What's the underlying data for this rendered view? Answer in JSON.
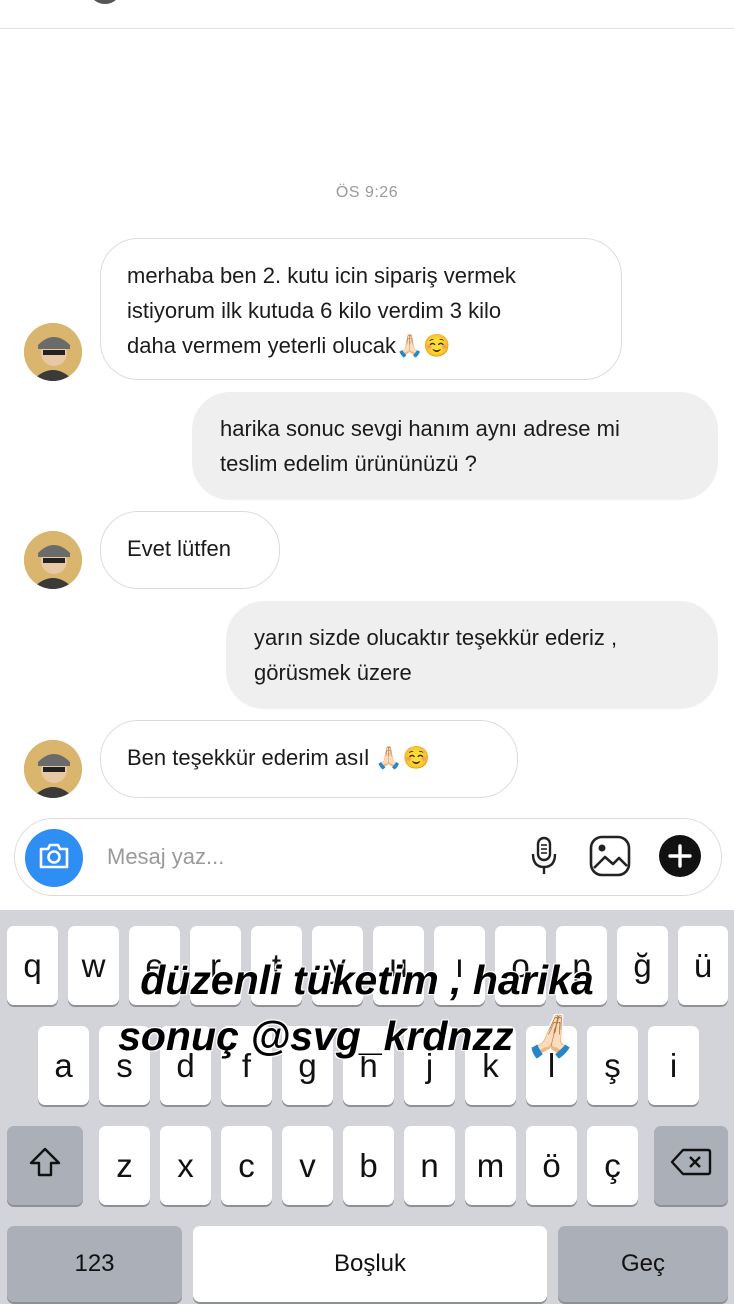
{
  "timestamp": "ÖS 9:26",
  "messages": [
    {
      "direction": "incoming",
      "lines": [
        "merhaba ben 2. kutu icin sipariş vermek",
        "istiyorum ilk kutuda 6 kilo verdim 3 kilo",
        "daha vermem yeterli olucak🙏🏻☺️"
      ]
    },
    {
      "direction": "outgoing",
      "lines": [
        "harika sonuc sevgi hanım aynı adrese mi",
        "teslim edelim ürününüzü ?"
      ]
    },
    {
      "direction": "incoming",
      "lines": [
        "Evet lütfen"
      ]
    },
    {
      "direction": "outgoing",
      "lines": [
        "yarın sizde olucaktır teşekkür ederiz ,",
        "görüsmek üzere"
      ]
    },
    {
      "direction": "incoming",
      "lines": [
        "Ben teşekkür ederim asıl 🙏🏻☺️"
      ]
    }
  ],
  "composer": {
    "placeholder": "Mesaj yaz...",
    "camera_icon": "camera-icon",
    "mic_icon": "microphone-icon",
    "gallery_icon": "gallery-icon",
    "plus_icon": "plus-icon"
  },
  "keyboard": {
    "row1": [
      "q",
      "w",
      "e",
      "r",
      "t",
      "y",
      "u",
      "ı",
      "o",
      "p",
      "ğ",
      "ü"
    ],
    "row2": [
      "a",
      "s",
      "d",
      "f",
      "g",
      "h",
      "j",
      "k",
      "l",
      "ş",
      "i"
    ],
    "row3": [
      "z",
      "x",
      "c",
      "v",
      "b",
      "n",
      "m",
      "ö",
      "ç"
    ],
    "shift_icon": "shift-icon",
    "backspace_icon": "backspace-icon",
    "numbers_label": "123",
    "space_label": "Boşluk",
    "return_label": "Geç"
  },
  "overlay_text": {
    "line1": "düzenli tüketim , harika",
    "line2": "sonuç @svg_krdnzz 🙏🏻"
  },
  "colors": {
    "accent_blue": "#2f8ef4",
    "outgoing_bubble": "#efefef",
    "keyboard_bg": "#d2d4da"
  }
}
